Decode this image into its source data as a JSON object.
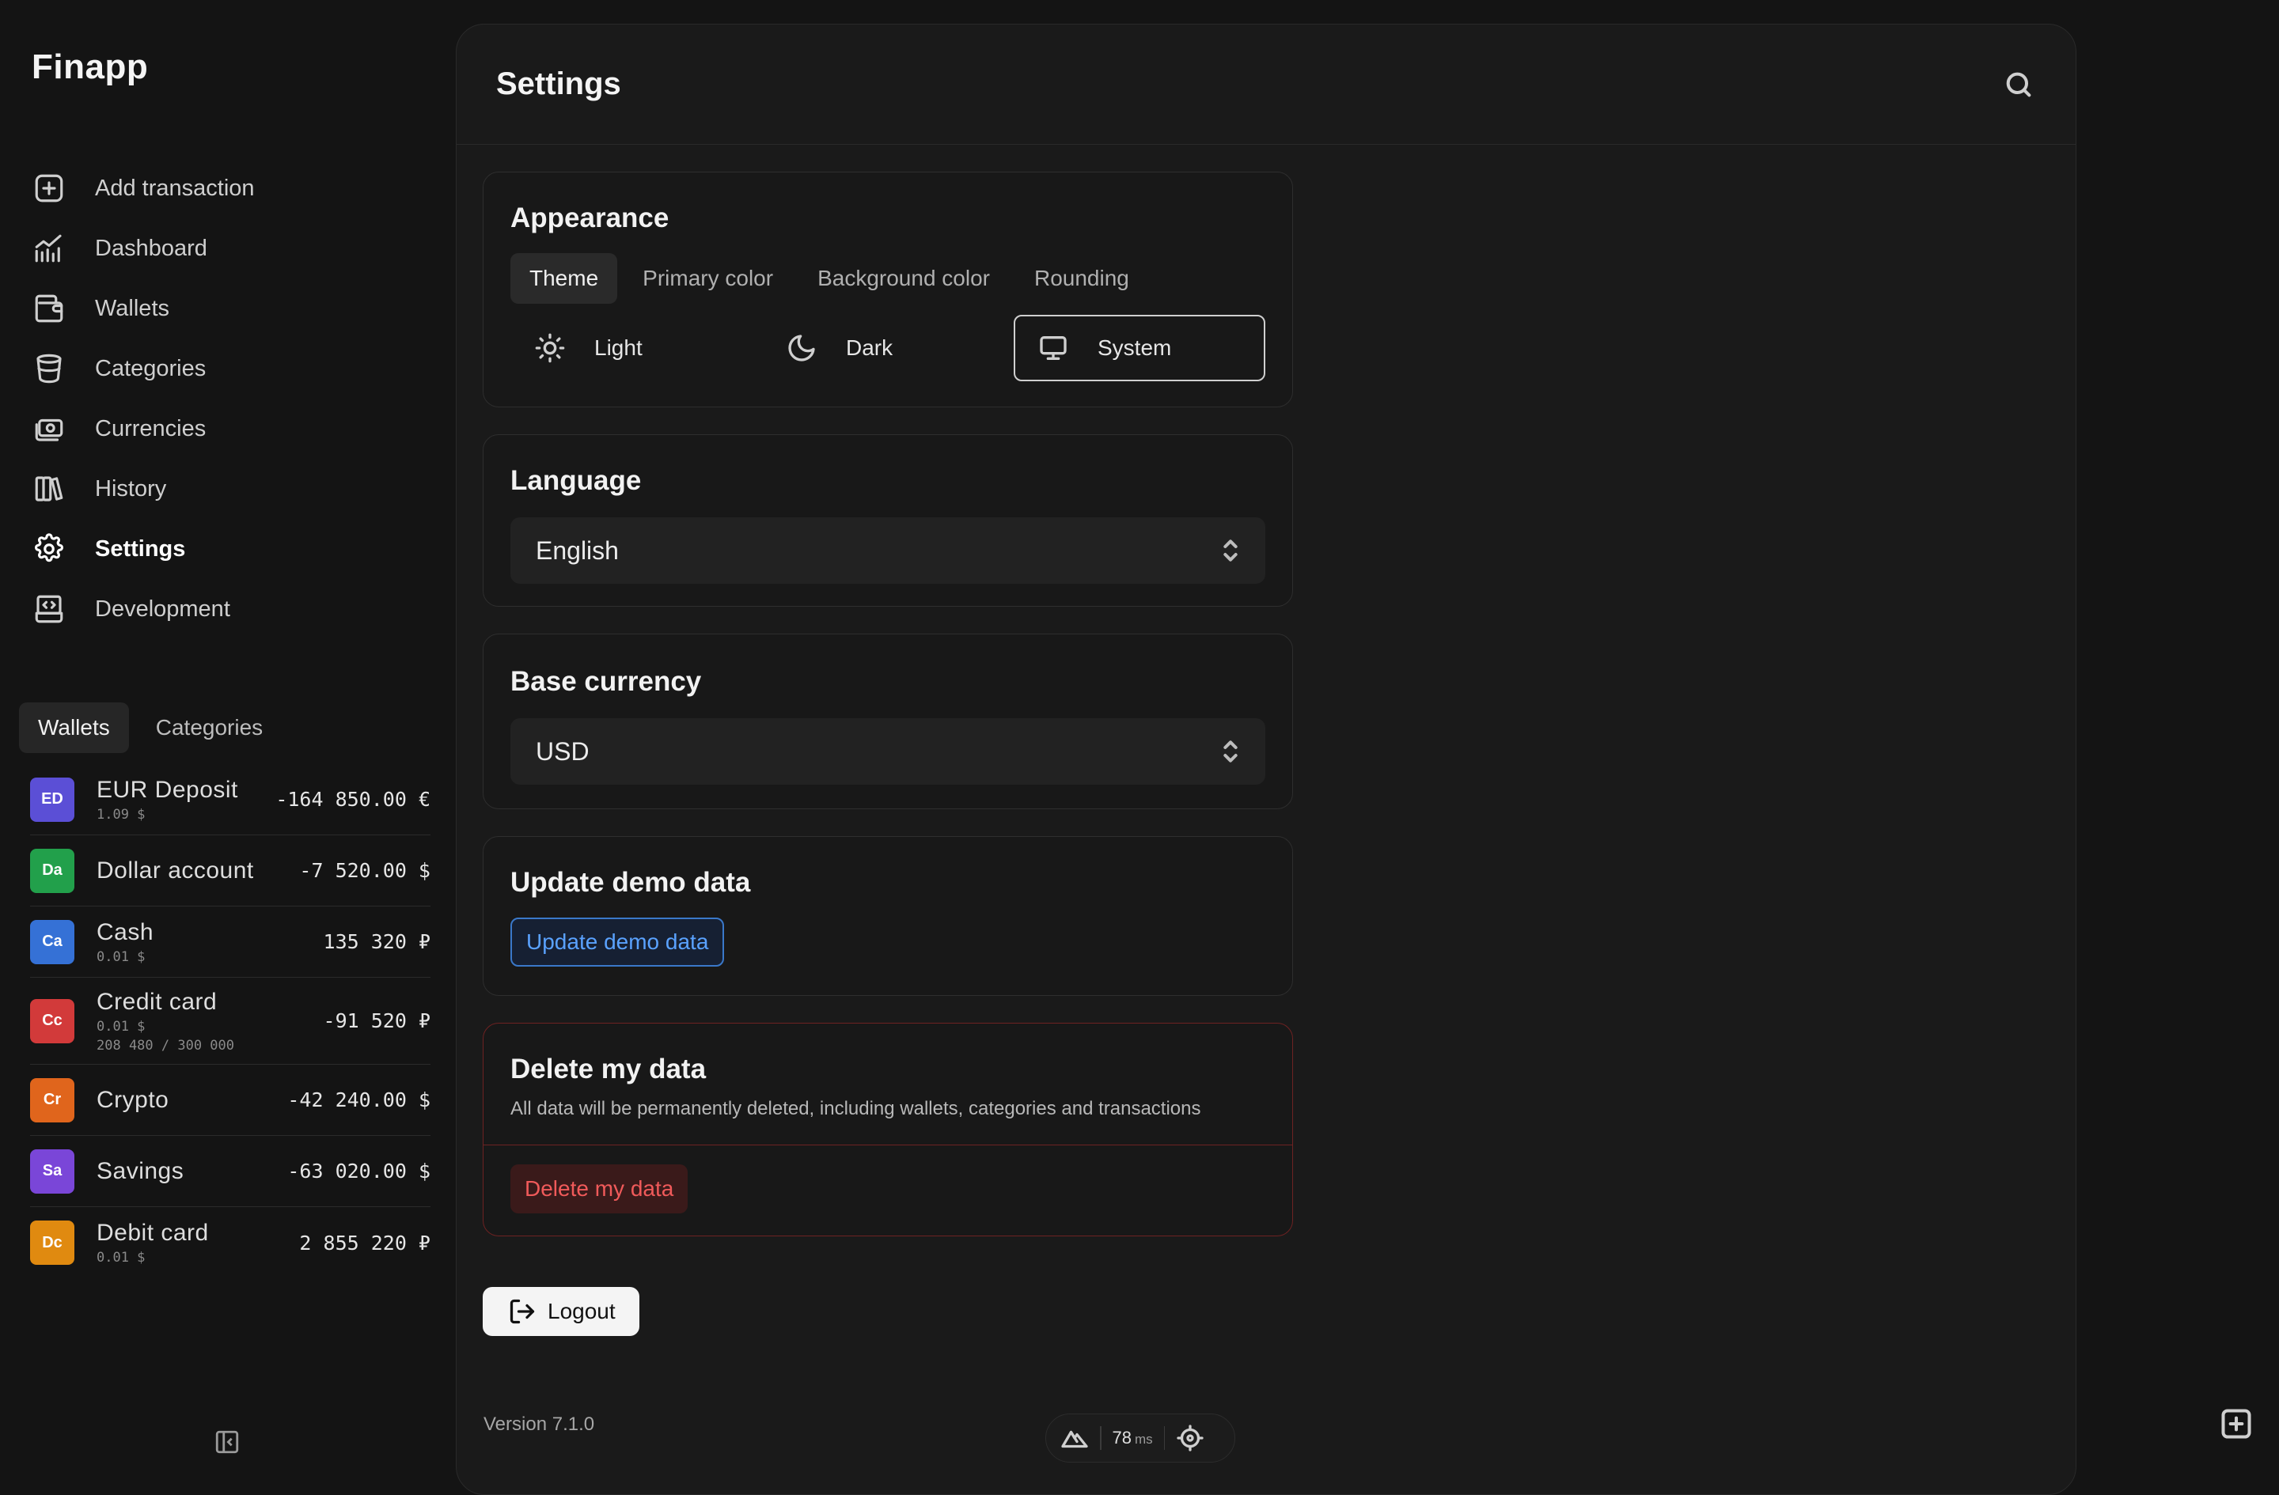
{
  "app": {
    "brand": "Finapp"
  },
  "nav": {
    "items": [
      {
        "label": "Add transaction",
        "icon": "plus-square-icon"
      },
      {
        "label": "Dashboard",
        "icon": "chart-line-icon"
      },
      {
        "label": "Wallets",
        "icon": "wallet-icon"
      },
      {
        "label": "Categories",
        "icon": "bucket-icon"
      },
      {
        "label": "Currencies",
        "icon": "cash-icon"
      },
      {
        "label": "History",
        "icon": "books-icon"
      },
      {
        "label": "Settings",
        "icon": "gear-icon",
        "active": true
      },
      {
        "label": "Development",
        "icon": "code-device-icon"
      }
    ]
  },
  "sidebar_tabs": {
    "wallets": "Wallets",
    "categories": "Categories"
  },
  "wallets": [
    {
      "initials": "ED",
      "name": "EUR Deposit",
      "sub": "1.09 $",
      "amount": "-164 850.00 €",
      "color": "#5b4fd6"
    },
    {
      "initials": "Da",
      "name": "Dollar account",
      "sub": "",
      "amount": "-7 520.00 $",
      "color": "#22a04b"
    },
    {
      "initials": "Ca",
      "name": "Cash",
      "sub": "0.01 $",
      "amount": "135 320 ₽",
      "color": "#3571d6"
    },
    {
      "initials": "Cc",
      "name": "Credit card",
      "sub": "0.01 $",
      "sub2": "208 480 / 300 000",
      "amount": "-91 520 ₽",
      "color": "#d23a3a"
    },
    {
      "initials": "Cr",
      "name": "Crypto",
      "sub": "",
      "amount": "-42 240.00 $",
      "color": "#e0651c"
    },
    {
      "initials": "Sa",
      "name": "Savings",
      "sub": "",
      "amount": "-63 020.00 $",
      "color": "#7a46d8"
    },
    {
      "initials": "Dc",
      "name": "Debit card",
      "sub": "0.01 $",
      "amount": "2 855 220 ₽",
      "color": "#e08a10"
    }
  ],
  "page": {
    "title": "Settings"
  },
  "appearance": {
    "title": "Appearance",
    "tabs": [
      "Theme",
      "Primary color",
      "Background color",
      "Rounding"
    ],
    "active_tab": "Theme",
    "themes": [
      {
        "label": "Light",
        "icon": "sun-icon"
      },
      {
        "label": "Dark",
        "icon": "moon-icon"
      },
      {
        "label": "System",
        "icon": "monitor-icon",
        "selected": true
      }
    ]
  },
  "language": {
    "title": "Language",
    "value": "English"
  },
  "base_currency": {
    "title": "Base currency",
    "value": "USD"
  },
  "demo": {
    "title": "Update demo data",
    "button": "Update demo data"
  },
  "delete": {
    "title": "Delete my data",
    "description": "All data will be permanently deleted, including wallets, categories and transactions",
    "button": "Delete my data"
  },
  "logout": {
    "label": "Logout"
  },
  "footer": {
    "version": "Version 7.1.0",
    "latency": "78",
    "latency_unit": "ms"
  },
  "colors": {
    "danger": "#f05a5a",
    "link": "#5aa2ff",
    "danger_border": "#7a2323"
  }
}
